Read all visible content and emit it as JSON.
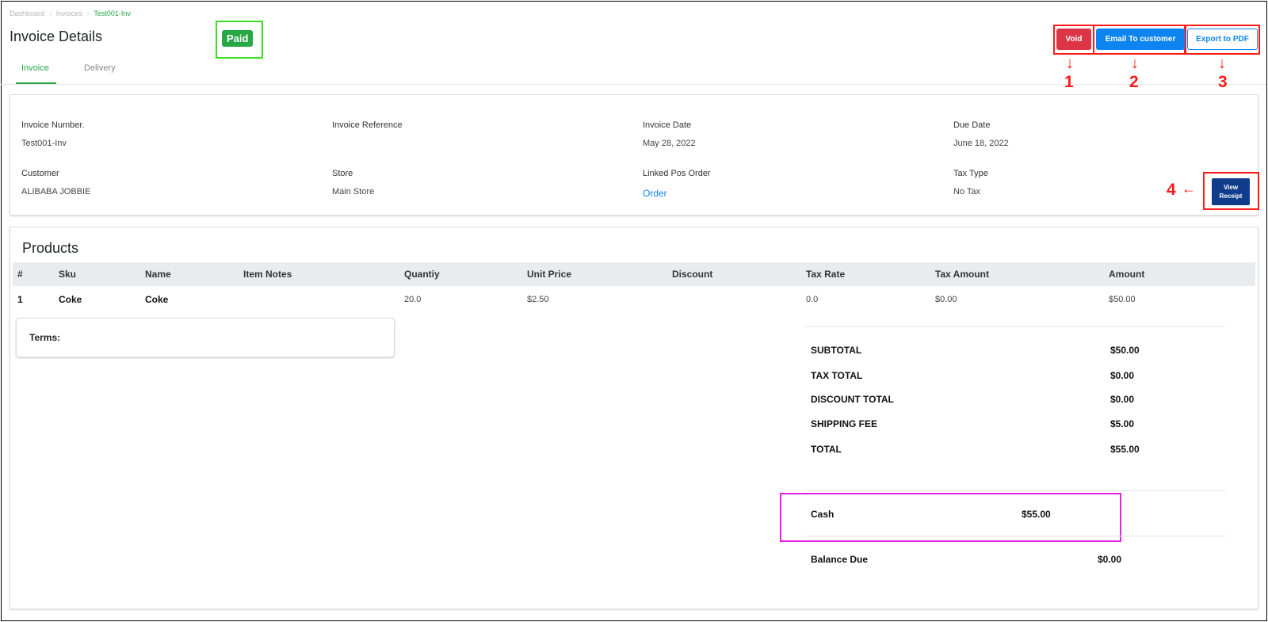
{
  "breadcrumb": {
    "items": [
      "Dashboard",
      "Invoices",
      "Test001-Inv"
    ],
    "separator": "›"
  },
  "header": {
    "title": "Invoice Details",
    "status_badge": "Paid"
  },
  "tabs": [
    {
      "label": "Invoice",
      "active": true
    },
    {
      "label": "Delivery",
      "active": false
    }
  ],
  "actions": {
    "void_label": "Void",
    "email_label": "Email To customer",
    "export_label": "Export to PDF",
    "view_receipt_line1": "View",
    "view_receipt_line2": "Receipt"
  },
  "annotations": {
    "marker_1": "1",
    "marker_2": "2",
    "marker_3": "3",
    "marker_4": "4"
  },
  "invoice_info": {
    "invoice_number": {
      "label": "Invoice Number.",
      "value": "Test001-Inv"
    },
    "invoice_reference": {
      "label": "Invoice Reference",
      "value": ""
    },
    "invoice_date": {
      "label": "Invoice Date",
      "value": "May 28, 2022"
    },
    "due_date": {
      "label": "Due Date",
      "value": "June 18, 2022"
    },
    "customer": {
      "label": "Customer",
      "value": "ALIBABA JOBBIE"
    },
    "store": {
      "label": "Store",
      "value": "Main Store"
    },
    "linked_pos_order": {
      "label": "Linked Pos Order",
      "value": "Order"
    },
    "tax_type": {
      "label": "Tax Type",
      "value": "No Tax"
    }
  },
  "products": {
    "title": "Products",
    "columns": [
      "#",
      "Sku",
      "Name",
      "Item Notes",
      "Quantiy",
      "Unit Price",
      "Discount",
      "Tax Rate",
      "Tax Amount",
      "Amount"
    ],
    "rows": [
      {
        "index": "1",
        "sku": "Coke",
        "name": "Coke",
        "notes": "",
        "quantity": "20.0",
        "unit_price": "$2.50",
        "discount": "",
        "tax_rate": "0.0",
        "tax_amount": "$0.00",
        "amount": "$50.00"
      }
    ]
  },
  "terms": {
    "label": "Terms:"
  },
  "totals": {
    "subtotal": {
      "label": "SUBTOTAL",
      "value": "$50.00"
    },
    "tax_total": {
      "label": "TAX TOTAL",
      "value": "$0.00"
    },
    "discount_total": {
      "label": "DISCOUNT TOTAL",
      "value": "$0.00"
    },
    "shipping_fee": {
      "label": "SHIPPING FEE",
      "value": "$5.00"
    },
    "total": {
      "label": "TOTAL",
      "value": "$55.00"
    }
  },
  "payments": [
    {
      "method": "Cash",
      "amount": "$55.00"
    }
  ],
  "balance_due": {
    "label": "Balance Due",
    "value": "$0.00"
  },
  "colors": {
    "accent_green": "#28a745",
    "void_red": "#dc3545",
    "primary_blue": "#0d84f0",
    "receipt_navy": "#0f3d8c",
    "highlight_red": "#ff1a1a",
    "highlight_green": "#39e01f",
    "highlight_magenta": "#e61ee6"
  }
}
